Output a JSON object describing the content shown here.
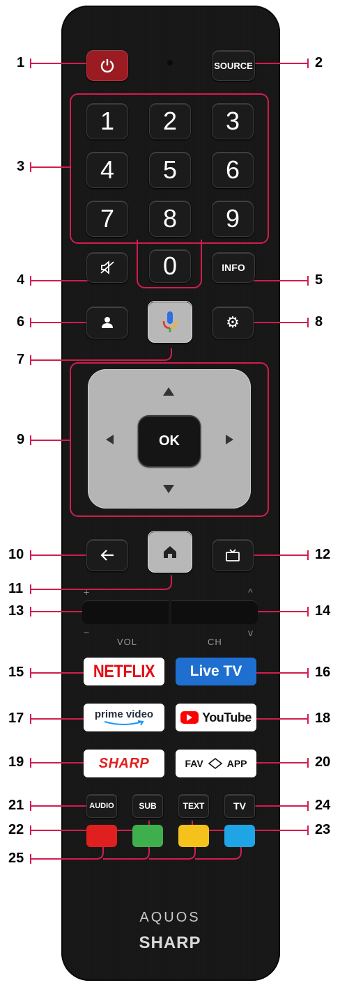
{
  "callouts": [
    "1",
    "2",
    "3",
    "4",
    "5",
    "6",
    "7",
    "8",
    "9",
    "10",
    "11",
    "12",
    "13",
    "14",
    "15",
    "16",
    "17",
    "18",
    "19",
    "20",
    "21",
    "22",
    "23",
    "24",
    "25"
  ],
  "buttons": {
    "source": "SOURCE",
    "digits": [
      "1",
      "2",
      "3",
      "4",
      "5",
      "6",
      "7",
      "8",
      "9",
      "0"
    ],
    "info": "INFO",
    "ok": "OK",
    "audio": "AUDIO",
    "sub": "SUB",
    "text": "TEXT",
    "tv": "TV"
  },
  "rocker": {
    "vol": "VOL",
    "ch": "CH",
    "plus": "+",
    "minus": "−",
    "up": "^",
    "down": "v"
  },
  "streaming": {
    "netflix": "NETFLIX",
    "livetv": "Live TV",
    "prime": "prime video",
    "youtube": "YouTube",
    "sharp": "SHARP",
    "fav": "FAV",
    "app": "APP"
  },
  "branding": {
    "model": "AQUOS",
    "brand": "SHARP"
  },
  "colors": {
    "accent": "#d21d4e",
    "power": "#9b1b22",
    "red": "#e0201f",
    "green": "#3fae4c",
    "yellow": "#f5c21b",
    "blue": "#1fa4e5",
    "livetv": "#1f6fd1"
  }
}
